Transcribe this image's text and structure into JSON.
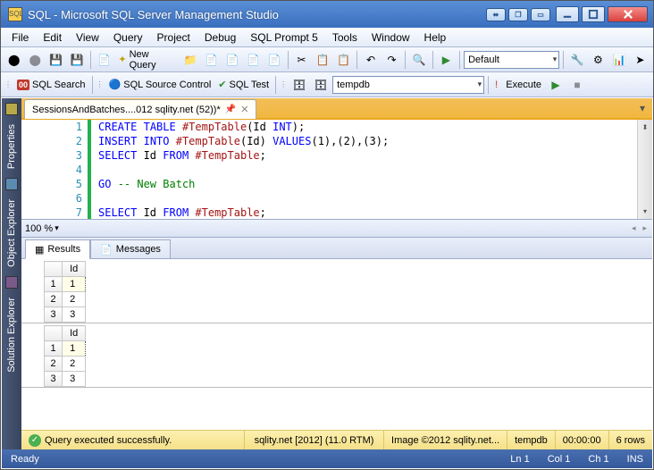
{
  "title": "SQL - Microsoft SQL Server Management Studio",
  "menu": [
    "File",
    "Edit",
    "View",
    "Query",
    "Project",
    "Debug",
    "SQL Prompt 5",
    "Tools",
    "Window",
    "Help"
  ],
  "toolbar1": {
    "new_query": "New Query",
    "config_combo": "Default"
  },
  "toolbar2": {
    "sql_search": "SQL Search",
    "sql_source": "SQL Source Control",
    "sql_test": "SQL Test",
    "db_combo": "tempdb",
    "execute": "Execute"
  },
  "sidetabs": [
    "Properties",
    "Object Explorer",
    "Solution Explorer"
  ],
  "doc_tab": "SessionsAndBatches....012 sqlity.net (52))*",
  "code_lines": [
    {
      "n": "1",
      "html": "<span class='kw'>CREATE</span> <span class='kw'>TABLE</span> <span class='obj'>#TempTable</span>(Id <span class='kw'>INT</span>);"
    },
    {
      "n": "2",
      "html": "<span class='kw'>INSERT</span> <span class='kw'>INTO</span> <span class='obj'>#TempTable</span>(Id) <span class='kw'>VALUES</span>(1),(2),(3);"
    },
    {
      "n": "3",
      "html": "<span class='kw'>SELECT</span> Id <span class='kw'>FROM</span> <span class='obj'>#TempTable</span>;"
    },
    {
      "n": "4",
      "html": ""
    },
    {
      "n": "5",
      "html": "<span class='kw'>GO</span> <span class='cmt'>-- New Batch</span>"
    },
    {
      "n": "6",
      "html": ""
    },
    {
      "n": "7",
      "html": "<span class='kw'>SELECT</span> Id <span class='kw'>FROM</span> <span class='obj'>#TempTable</span>;"
    }
  ],
  "zoom": "100 %",
  "results_tab": "Results",
  "messages_tab": "Messages",
  "grids": [
    {
      "header": "Id",
      "rows": [
        [
          "1",
          "1"
        ],
        [
          "2",
          "2"
        ],
        [
          "3",
          "3"
        ]
      ]
    },
    {
      "header": "Id",
      "rows": [
        [
          "1",
          "1"
        ],
        [
          "2",
          "2"
        ],
        [
          "3",
          "3"
        ]
      ]
    }
  ],
  "status": {
    "exec": "Query executed successfully.",
    "server": "sqlity.net [2012] (11.0 RTM)",
    "image": "Image ©2012 sqlity.net...",
    "db": "tempdb",
    "time": "00:00:00",
    "rows": "6 rows"
  },
  "bottom": {
    "ready": "Ready",
    "ln": "Ln 1",
    "col": "Col 1",
    "ch": "Ch 1",
    "ins": "INS"
  }
}
